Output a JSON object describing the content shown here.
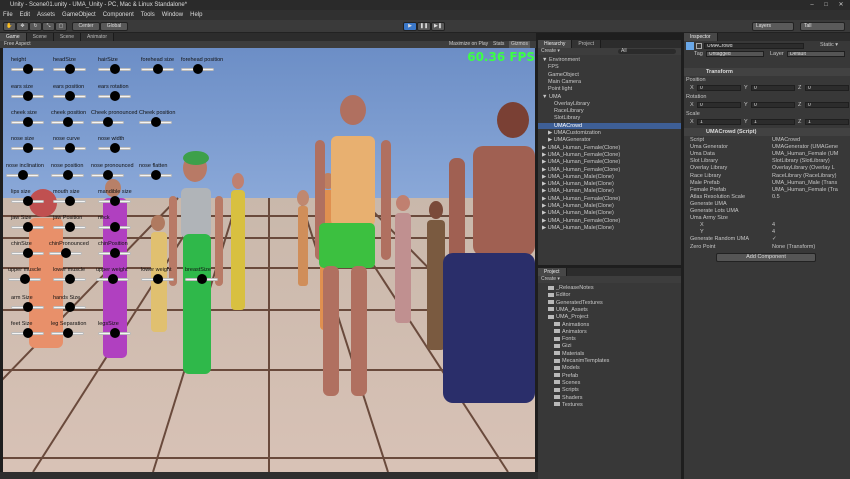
{
  "window": {
    "title": "Unity - Scene01.unity - UMA_Unity - PC, Mac & Linux Standalone*",
    "minimize": "–",
    "maximize": "□",
    "close": "✕"
  },
  "menu": [
    "File",
    "Edit",
    "Assets",
    "GameObject",
    "Component",
    "Tools",
    "Window",
    "Help"
  ],
  "toolbar": {
    "pivot": "Center",
    "space": "Global",
    "play": "▶",
    "pause": "❚❚",
    "step": "▶❚",
    "layers": "Layers",
    "layout": "Tall"
  },
  "scene_tabs": [
    "Game",
    "Scene",
    "Scene",
    "Animator"
  ],
  "game": {
    "aspect": "Free Aspect",
    "maximize_label": "Maximize on Play",
    "stats_label": "Stats",
    "gizmos_label": "Gizmos",
    "fps": "60.36 FPS"
  },
  "sliders": [
    {
      "label": "height",
      "value": 0.5
    },
    {
      "label": "headSize",
      "value": 0.5
    },
    {
      "label": "hairSize",
      "value": 0.5
    },
    {
      "label": "forehead size",
      "value": 0.5
    },
    {
      "label": "forehead position",
      "value": 0.5
    },
    {
      "label": "ears size",
      "value": 0.5
    },
    {
      "label": "ears position",
      "value": 0.5
    },
    {
      "label": "ears rotation",
      "value": 0.5
    },
    {
      "label": "cheek size",
      "value": 0.5
    },
    {
      "label": "cheek position",
      "value": 0.5
    },
    {
      "label": "Cheek pronounced",
      "value": 0.5
    },
    {
      "label": "Cheek position",
      "value": 0.5
    },
    {
      "label": "nose size",
      "value": 0.5
    },
    {
      "label": "nose curve",
      "value": 0.5
    },
    {
      "label": "nose width",
      "value": 0.5
    },
    {
      "label": "nose inclination",
      "value": 0.5
    },
    {
      "label": "nose position",
      "value": 0.5
    },
    {
      "label": "nose pronounced",
      "value": 0.5
    },
    {
      "label": "nose flatten",
      "value": 0.5
    },
    {
      "label": "lips size",
      "value": 0.5
    },
    {
      "label": "mouth size",
      "value": 0.5
    },
    {
      "label": "mandible size",
      "value": 0.5
    },
    {
      "label": "jaw Size",
      "value": 0.5
    },
    {
      "label": "jaw Position",
      "value": 0.5
    },
    {
      "label": "neck",
      "value": 0.5
    },
    {
      "label": "chinSize",
      "value": 0.5
    },
    {
      "label": "chinPronounced",
      "value": 0.5
    },
    {
      "label": "chinPosition",
      "value": 0.5
    },
    {
      "label": "upper muscle",
      "value": 0.5
    },
    {
      "label": "lower muscle",
      "value": 0.5
    },
    {
      "label": "upper weight",
      "value": 0.5
    },
    {
      "label": "lower weight",
      "value": 0.5
    },
    {
      "label": "breastSize",
      "value": 0.5
    },
    {
      "label": "arm Size",
      "value": 0.5
    },
    {
      "label": "hands Size",
      "value": 0.5
    },
    {
      "label": "feet Size",
      "value": 0.5
    },
    {
      "label": "leg Separation",
      "value": 0.5
    },
    {
      "label": "legsSize",
      "value": 0.5
    }
  ],
  "hierarchy": {
    "tab": "Hierarchy",
    "create": "Create ▾",
    "search_placeholder": "All",
    "items": [
      {
        "text": "▼ Environment",
        "indent": 0
      },
      {
        "text": "FPS",
        "indent": 1
      },
      {
        "text": "GameObject",
        "indent": 1
      },
      {
        "text": "Main Camera",
        "indent": 1
      },
      {
        "text": "Point light",
        "indent": 1
      },
      {
        "text": "▼ UMA",
        "indent": 0
      },
      {
        "text": "OverlayLibrary",
        "indent": 2
      },
      {
        "text": "RaceLibrary",
        "indent": 2
      },
      {
        "text": "SlotLibrary",
        "indent": 2
      },
      {
        "text": "UMACrowd",
        "indent": 2,
        "selected": true
      },
      {
        "text": "▶ UMACustomization",
        "indent": 1
      },
      {
        "text": "▶ UMAGenerator",
        "indent": 1
      },
      {
        "text": "▶ UMA_Human_Female(Clone)",
        "indent": 0
      },
      {
        "text": "▶ UMA_Human_Female(Clone)",
        "indent": 0
      },
      {
        "text": "▶ UMA_Human_Female(Clone)",
        "indent": 0
      },
      {
        "text": "▶ UMA_Human_Female(Clone)",
        "indent": 0
      },
      {
        "text": "▶ UMA_Human_Male(Clone)",
        "indent": 0
      },
      {
        "text": "▶ UMA_Human_Male(Clone)",
        "indent": 0
      },
      {
        "text": "▶ UMA_Human_Male(Clone)",
        "indent": 0
      },
      {
        "text": "▶ UMA_Human_Female(Clone)",
        "indent": 0
      },
      {
        "text": "▶ UMA_Human_Male(Clone)",
        "indent": 0
      },
      {
        "text": "▶ UMA_Human_Male(Clone)",
        "indent": 0
      },
      {
        "text": "▶ UMA_Human_Female(Clone)",
        "indent": 0
      },
      {
        "text": "▶ UMA_Human_Male(Clone)",
        "indent": 0
      }
    ]
  },
  "project": {
    "tabs": [
      "Project"
    ],
    "create": "Create ▾",
    "items": [
      {
        "text": "_ReleaseNotes",
        "indent": 1
      },
      {
        "text": "Editor",
        "indent": 1
      },
      {
        "text": "GeneratedTextures",
        "indent": 1
      },
      {
        "text": "UMA_Assets",
        "indent": 1
      },
      {
        "text": "UMA_Project",
        "indent": 1
      },
      {
        "text": "Animations",
        "indent": 2
      },
      {
        "text": "Animators",
        "indent": 2
      },
      {
        "text": "Fonts",
        "indent": 2
      },
      {
        "text": "Gizi",
        "indent": 2
      },
      {
        "text": "Materials",
        "indent": 2
      },
      {
        "text": "MecanimTemplates",
        "indent": 2
      },
      {
        "text": "Models",
        "indent": 2
      },
      {
        "text": "Prefab",
        "indent": 2
      },
      {
        "text": "Scenes",
        "indent": 2
      },
      {
        "text": "Scripts",
        "indent": 2
      },
      {
        "text": "Shaders",
        "indent": 2
      },
      {
        "text": "Textures",
        "indent": 2
      }
    ]
  },
  "inspector": {
    "tab": "Inspector",
    "object_name": "UMACrowd",
    "static_label": "Static ▾",
    "tag_label": "Tag",
    "tag_value": "Untagged",
    "layer_label": "Layer",
    "layer_value": "Default",
    "transform": {
      "title": "Transform",
      "position": "Position",
      "rotation": "Rotation",
      "scale": "Scale",
      "pos": [
        "0",
        "0",
        "0"
      ],
      "rot": [
        "0",
        "0",
        "0"
      ],
      "scl": [
        "1",
        "1",
        "1"
      ]
    },
    "script": {
      "title": "UMACrowd (Script)",
      "rows": [
        {
          "label": "Script",
          "value": "UMACrowd"
        },
        {
          "label": "Uma Generator",
          "value": "UMAGenerator (UMAGene"
        },
        {
          "label": "Uma Data",
          "value": "UMA_Human_Female (UM"
        },
        {
          "label": "Slot Library",
          "value": "SlotLibrary (SlotLibrary)"
        },
        {
          "label": "Overlay Library",
          "value": "OverlayLibrary (Overlay L"
        },
        {
          "label": "Race Library",
          "value": "RaceLibrary (RaceLibrary)"
        },
        {
          "label": "Male Prefab",
          "value": "UMA_Human_Male (Trans"
        },
        {
          "label": "Female Prefab",
          "value": "UMA_Human_Female (Tra"
        },
        {
          "label": "Atlas Resolution Scale",
          "value": "0.5"
        },
        {
          "label": "Generate UMA",
          "value": ""
        },
        {
          "label": "Generate Lots UMA",
          "value": ""
        },
        {
          "label": "Uma Army Size",
          "value": ""
        },
        {
          "label": "X",
          "value": "4"
        },
        {
          "label": "Y",
          "value": "4"
        },
        {
          "label": "Generate Random UMA",
          "value": "✓"
        },
        {
          "label": "Zero Point",
          "value": "None (Transform)"
        }
      ]
    },
    "add_component": "Add Component"
  }
}
